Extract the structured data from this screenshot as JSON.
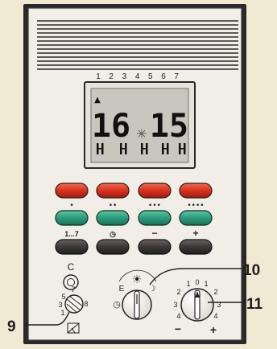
{
  "display": {
    "day_numbers": [
      "1",
      "2",
      "3",
      "4",
      "5",
      "6",
      "7"
    ],
    "day_indicator": "▲",
    "time_hours": "16",
    "time_minutes": "15",
    "sun_symbol": "✳"
  },
  "buttons": {
    "red_row_count": 4,
    "green_row_dots": [
      "•",
      "••",
      "•••",
      "••••"
    ],
    "bottom_row_labels": [
      "1...7",
      "◷",
      "−",
      "+"
    ]
  },
  "reset": {
    "label": "C"
  },
  "left_dial": {
    "numbers": [
      "7",
      "5",
      "3",
      "1",
      "8"
    ]
  },
  "mode_dial": {
    "labels": [
      "E",
      "☀",
      "☽",
      "◷"
    ]
  },
  "adjust_dial": {
    "numbers_left": [
      "2",
      "3",
      "4"
    ],
    "numbers_top": [
      "1",
      "0",
      "1"
    ],
    "numbers_right": [
      "2",
      "3",
      "4"
    ],
    "minus": "−",
    "plus": "+"
  },
  "callouts": {
    "c9": "9",
    "c10": "10",
    "c11": "11"
  },
  "colors": {
    "device_body": "#f1eee8",
    "lcd_bg": "#c9c6be",
    "red_button": "#d8311f",
    "green_button": "#2a9c7a",
    "dark_button": "#3b3838"
  }
}
